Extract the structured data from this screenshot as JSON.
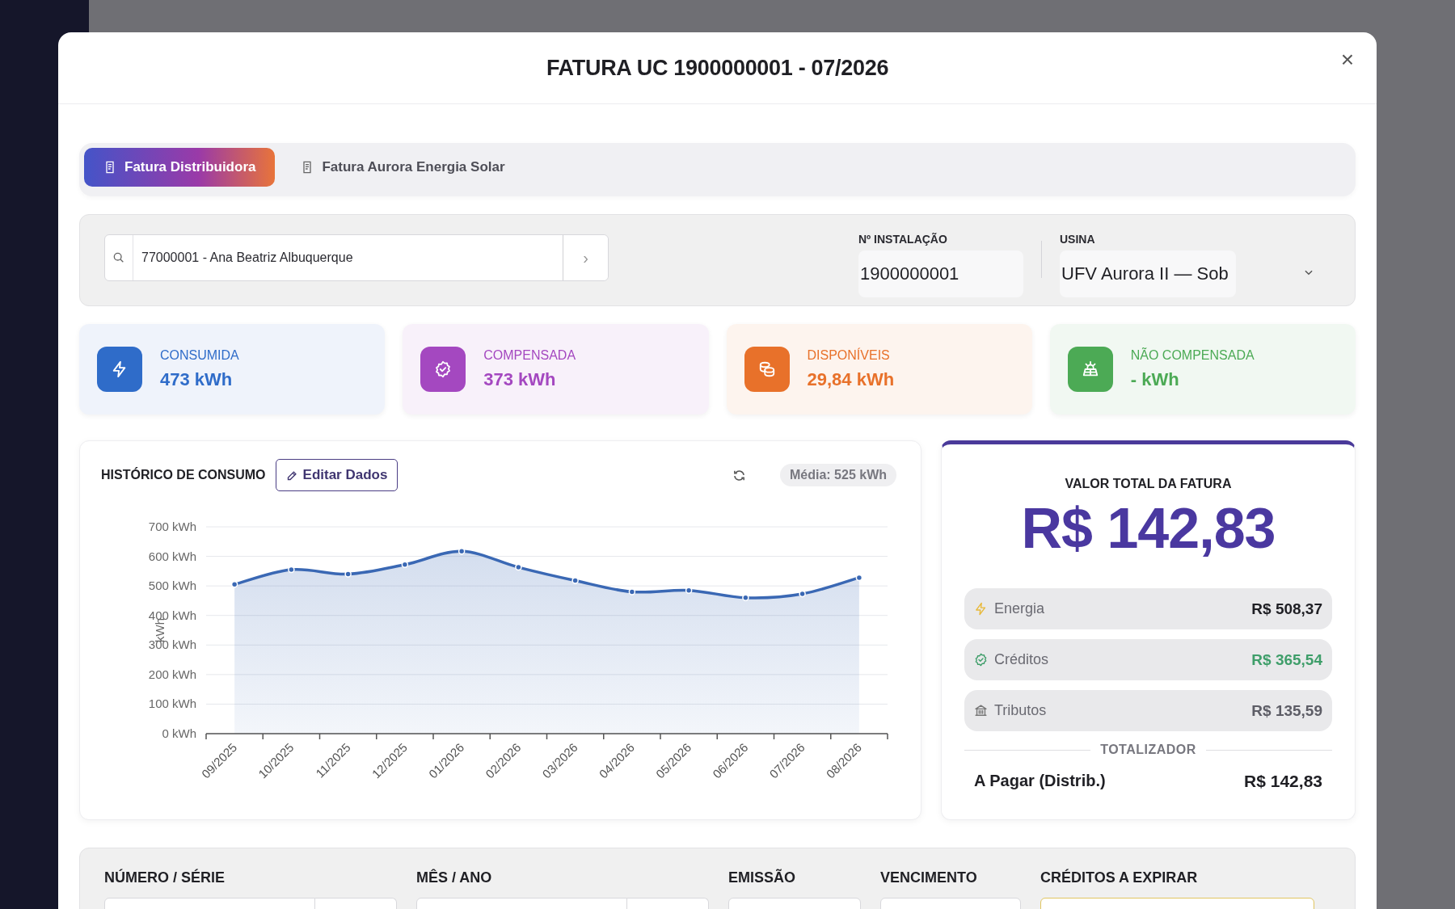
{
  "modal": {
    "title": "FATURA UC 1900000001 - 07/2026",
    "close": "×"
  },
  "tabs": [
    {
      "label": "Fatura Distribuidora",
      "selected": true
    },
    {
      "label": "Fatura Aurora Energia Solar",
      "selected": false
    }
  ],
  "search": {
    "value": "77000001 - Ana Beatriz Albuquerque",
    "go": "›"
  },
  "installation": {
    "label": "Nº INSTALAÇÃO",
    "value": "1900000001"
  },
  "plant": {
    "label": "USINA",
    "value": "UFV Aurora II — Sob"
  },
  "stats": [
    {
      "kind": "bolt",
      "label": "CONSUMIDA",
      "value": "473 kWh",
      "color": "#2f6cc9"
    },
    {
      "kind": "badge",
      "label": "COMPENSADA",
      "value": "373 kWh",
      "color": "#a448c0"
    },
    {
      "kind": "coins",
      "label": "DISPONÍVEIS",
      "value": "29,84 kWh",
      "color": "#e8712a"
    },
    {
      "kind": "solar",
      "label": "NÃO COMPENSADA",
      "value": "- kWh",
      "color": "#4caa55"
    }
  ],
  "history": {
    "title": "HISTÓRICO DE CONSUMO",
    "edit": "Editar Dados",
    "average": "Média: 525 kWh",
    "chart_data": {
      "type": "area",
      "ylabel": "kWh",
      "categories": [
        "09/2025",
        "10/2025",
        "11/2025",
        "12/2025",
        "01/2026",
        "02/2026",
        "03/2026",
        "04/2026",
        "05/2026",
        "06/2026",
        "07/2026",
        "08/2026"
      ],
      "grid": true,
      "series": [
        {
          "color": "#3a68b4",
          "values": [
            505,
            555,
            540,
            572,
            617,
            563,
            518,
            480,
            485,
            460,
            473,
            528
          ]
        }
      ],
      "ylim": [
        0,
        700
      ],
      "yticks": [
        {
          "value": 0,
          "label": "0 kWh"
        },
        {
          "value": 100,
          "label": "100 kWh"
        },
        {
          "value": 200,
          "label": "200 kWh"
        },
        {
          "value": 300,
          "label": "300 kWh"
        },
        {
          "value": 400,
          "label": "400 kWh"
        },
        {
          "value": 500,
          "label": "500 kWh"
        },
        {
          "value": 600,
          "label": "600 kWh"
        },
        {
          "value": 700,
          "label": "700 kWh"
        }
      ]
    }
  },
  "total": {
    "title": "VALOR TOTAL DA FATURA",
    "amount": "R$ 142,83",
    "items": [
      {
        "kind": "bolt",
        "label": "Energia",
        "value": "R$ 508,37",
        "color": "#1f1f24"
      },
      {
        "kind": "badge",
        "label": "Créditos",
        "value": "R$ 365,54",
        "color": "#3f9e6a"
      },
      {
        "kind": "bank",
        "label": "Tributos",
        "value": "R$ 135,59",
        "color": "#5d5d66"
      }
    ],
    "divider": "TOTALIZADOR",
    "due_label": "A Pagar (Distrib.)",
    "due_value": "R$ 142,83"
  },
  "invoice_fields": [
    {
      "label": "NÚMERO / SÉRIE",
      "kind": "split"
    },
    {
      "label": "MÊS / ANO",
      "kind": "split"
    },
    {
      "label": "EMISSÃO",
      "kind": "single"
    },
    {
      "label": "VENCIMENTO",
      "kind": "single"
    },
    {
      "label": "CRÉDITOS A EXPIRAR",
      "kind": "highlight"
    }
  ]
}
